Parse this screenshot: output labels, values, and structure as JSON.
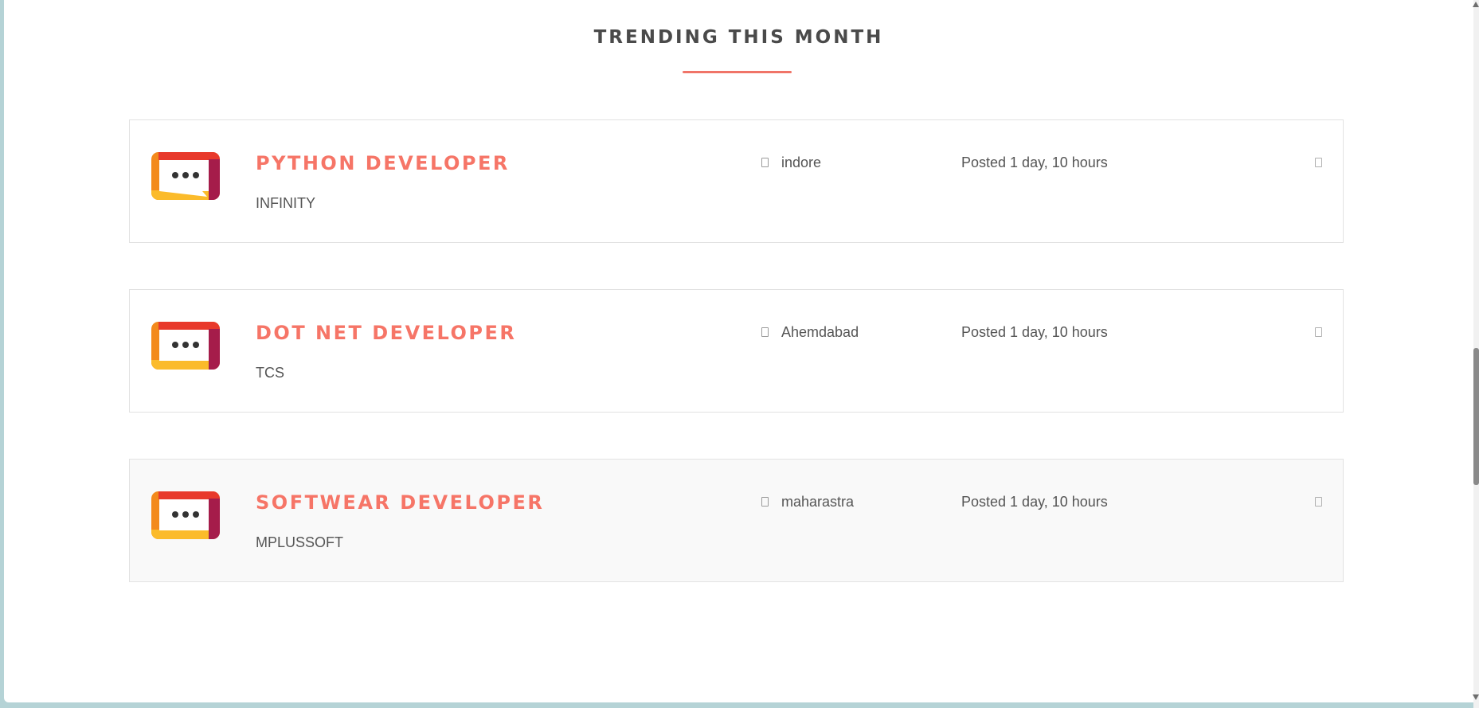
{
  "section": {
    "title": "TRENDING THIS MONTH",
    "accent_color": "#f07468"
  },
  "jobs": [
    {
      "title": "PYTHON DEVELOPER",
      "company": "INFINITY",
      "location": "indore",
      "posted": "Posted 1 day, 10 hours",
      "logo_icon": "chat-bubble-logo-icon"
    },
    {
      "title": "DOT NET DEVELOPER",
      "company": "TCS",
      "location": "Ahemdabad",
      "posted": "Posted 1 day, 10 hours",
      "logo_icon": "chat-bubble-logo-icon"
    },
    {
      "title": "SOFTWEAR DEVELOPER",
      "company": "MPLUSSOFT",
      "location": "maharastra",
      "posted": "Posted 1 day, 10 hours",
      "logo_icon": "chat-bubble-logo-icon"
    }
  ],
  "colors": {
    "job_title": "#f67567",
    "text": "#555555",
    "heading": "#4a4a4a"
  }
}
